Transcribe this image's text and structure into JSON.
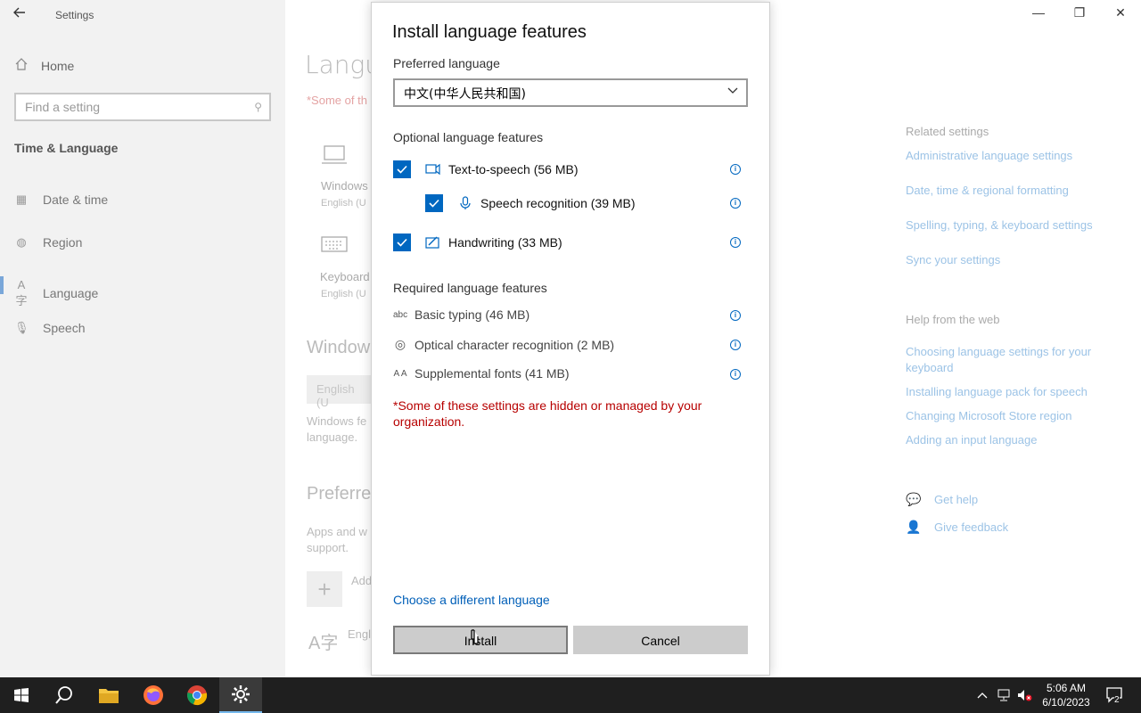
{
  "window": {
    "title": "Settings",
    "controls": {
      "minimize": "—",
      "restore": "❐",
      "close": "✕"
    }
  },
  "sidebar": {
    "home": "Home",
    "search_placeholder": "Find a setting",
    "section": "Time & Language",
    "items": [
      {
        "label": "Date & time",
        "icon": "calendar-icon"
      },
      {
        "label": "Region",
        "icon": "globe-icon"
      },
      {
        "label": "Language",
        "icon": "language-icon"
      },
      {
        "label": "Speech",
        "icon": "microphone-icon"
      }
    ]
  },
  "background": {
    "heading": "Langu",
    "red_note": "*Some of th",
    "tile1_label": "Windows",
    "tile1_sub": "English (U",
    "tile2_label": "Keyboard",
    "tile2_sub": "English (U",
    "section1": "Window",
    "select_value": "English (U",
    "text1": "Windows fe",
    "text2": "language.",
    "section2": "Preferre",
    "text3": "Apps and w",
    "text4": "support.",
    "add_label": "Add",
    "lang_label": "Engl"
  },
  "right_panel": {
    "related_heading": "Related settings",
    "related_links": [
      "Administrative language settings",
      "Date, time & regional formatting",
      "Spelling, typing, & keyboard settings",
      "Sync your settings"
    ],
    "help_heading": "Help from the web",
    "help_links": [
      "Choosing language settings for your keyboard",
      "Installing language pack for speech",
      "Changing Microsoft Store region",
      "Adding an input language"
    ],
    "get_help": "Get help",
    "give_feedback": "Give feedback"
  },
  "dialog": {
    "title": "Install language features",
    "preferred_label": "Preferred language",
    "preferred_value": "中文(中华人民共和国)",
    "optional_label": "Optional language features",
    "optional": [
      {
        "label": "Text-to-speech (56 MB)",
        "checked": true,
        "icon": "text-to-speech-icon"
      },
      {
        "label": "Speech recognition (39 MB)",
        "checked": true,
        "icon": "microphone-icon"
      },
      {
        "label": "Handwriting (33 MB)",
        "checked": true,
        "icon": "handwriting-icon"
      }
    ],
    "required_label": "Required language features",
    "required": [
      {
        "label": "Basic typing (46 MB)",
        "icon": "abc-icon",
        "glyph": "abc"
      },
      {
        "label": "Optical character recognition (2 MB)",
        "icon": "ocr-icon",
        "glyph": "◎"
      },
      {
        "label": "Supplemental fonts (41 MB)",
        "icon": "fonts-icon",
        "glyph": "A A"
      }
    ],
    "red_note": "*Some of these settings are hidden or managed by your organization.",
    "choose_link": "Choose a different language",
    "install_button": "Install",
    "cancel_button": "Cancel",
    "accent": "#0067c0"
  },
  "taskbar": {
    "apps": [
      "start-icon",
      "search-icon",
      "file-explorer-icon",
      "firefox-icon",
      "chrome-icon",
      "settings-icon"
    ],
    "time": "5:06 AM",
    "date": "6/10/2023",
    "notification_count": "2"
  }
}
